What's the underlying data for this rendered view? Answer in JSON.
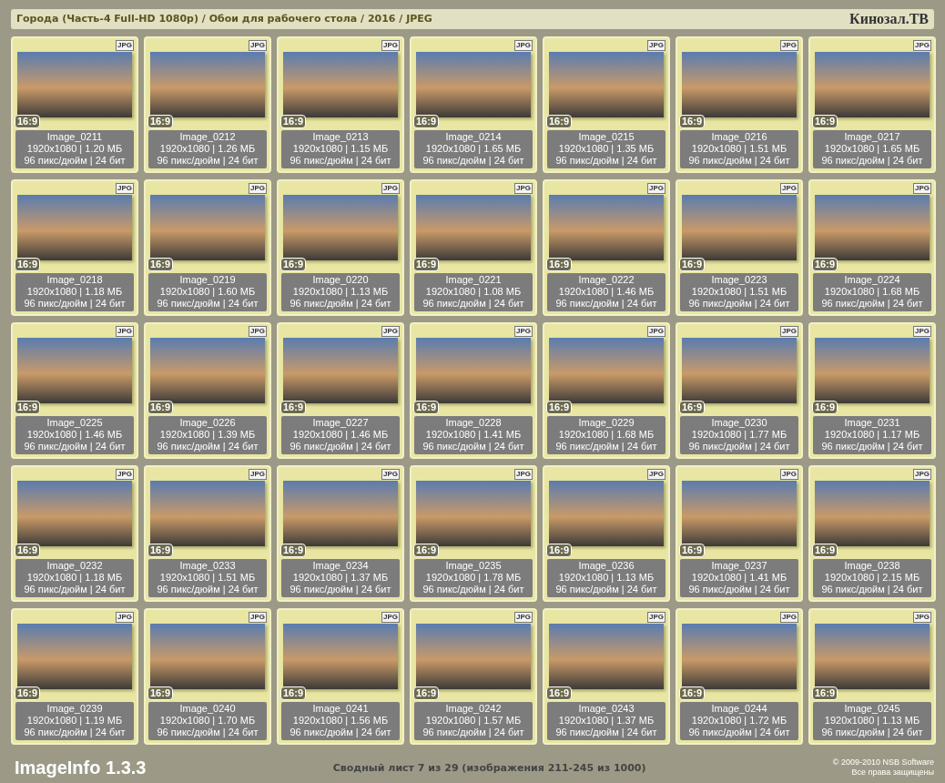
{
  "header": {
    "title": "Города (Часть-4 Full-HD 1080p) / Обои для рабочего стола / 2016 / JPEG",
    "site": "Кинозал.ТВ"
  },
  "tiles": [
    {
      "format": "JPG",
      "ratio": "16:9",
      "name": "Image_0211",
      "size": "1920x1080 | 1.20 МБ",
      "info": "96 пикс/дюйм | 24 бит"
    },
    {
      "format": "JPG",
      "ratio": "16:9",
      "name": "Image_0212",
      "size": "1920x1080 | 1.26 МБ",
      "info": "96 пикс/дюйм | 24 бит"
    },
    {
      "format": "JPG",
      "ratio": "16:9",
      "name": "Image_0213",
      "size": "1920x1080 | 1.15 МБ",
      "info": "96 пикс/дюйм | 24 бит"
    },
    {
      "format": "JPG",
      "ratio": "16:9",
      "name": "Image_0214",
      "size": "1920x1080 | 1.65 МБ",
      "info": "96 пикс/дюйм | 24 бит"
    },
    {
      "format": "JPG",
      "ratio": "16:9",
      "name": "Image_0215",
      "size": "1920x1080 | 1.35 МБ",
      "info": "96 пикс/дюйм | 24 бит"
    },
    {
      "format": "JPG",
      "ratio": "16:9",
      "name": "Image_0216",
      "size": "1920x1080 | 1.51 МБ",
      "info": "96 пикс/дюйм | 24 бит"
    },
    {
      "format": "JPG",
      "ratio": "16:9",
      "name": "Image_0217",
      "size": "1920x1080 | 1.65 МБ",
      "info": "96 пикс/дюйм | 24 бит"
    },
    {
      "format": "JPG",
      "ratio": "16:9",
      "name": "Image_0218",
      "size": "1920x1080 | 1.18 МБ",
      "info": "96 пикс/дюйм | 24 бит"
    },
    {
      "format": "JPG",
      "ratio": "16:9",
      "name": "Image_0219",
      "size": "1920x1080 | 1.60 МБ",
      "info": "96 пикс/дюйм | 24 бит"
    },
    {
      "format": "JPG",
      "ratio": "16:9",
      "name": "Image_0220",
      "size": "1920x1080 | 1.13 МБ",
      "info": "96 пикс/дюйм | 24 бит"
    },
    {
      "format": "JPG",
      "ratio": "16:9",
      "name": "Image_0221",
      "size": "1920x1080 | 1.08 МБ",
      "info": "96 пикс/дюйм | 24 бит"
    },
    {
      "format": "JPG",
      "ratio": "16:9",
      "name": "Image_0222",
      "size": "1920x1080 | 1.46 МБ",
      "info": "96 пикс/дюйм | 24 бит"
    },
    {
      "format": "JPG",
      "ratio": "16:9",
      "name": "Image_0223",
      "size": "1920x1080 | 1.51 МБ",
      "info": "96 пикс/дюйм | 24 бит"
    },
    {
      "format": "JPG",
      "ratio": "16:9",
      "name": "Image_0224",
      "size": "1920x1080 | 1.68 МБ",
      "info": "96 пикс/дюйм | 24 бит"
    },
    {
      "format": "JPG",
      "ratio": "16:9",
      "name": "Image_0225",
      "size": "1920x1080 | 1.46 МБ",
      "info": "96 пикс/дюйм | 24 бит"
    },
    {
      "format": "JPG",
      "ratio": "16:9",
      "name": "Image_0226",
      "size": "1920x1080 | 1.39 МБ",
      "info": "96 пикс/дюйм | 24 бит"
    },
    {
      "format": "JPG",
      "ratio": "16:9",
      "name": "Image_0227",
      "size": "1920x1080 | 1.46 МБ",
      "info": "96 пикс/дюйм | 24 бит"
    },
    {
      "format": "JPG",
      "ratio": "16:9",
      "name": "Image_0228",
      "size": "1920x1080 | 1.41 МБ",
      "info": "96 пикс/дюйм | 24 бит"
    },
    {
      "format": "JPG",
      "ratio": "16:9",
      "name": "Image_0229",
      "size": "1920x1080 | 1.68 МБ",
      "info": "96 пикс/дюйм | 24 бит"
    },
    {
      "format": "JPG",
      "ratio": "16:9",
      "name": "Image_0230",
      "size": "1920x1080 | 1.77 МБ",
      "info": "96 пикс/дюйм | 24 бит"
    },
    {
      "format": "JPG",
      "ratio": "16:9",
      "name": "Image_0231",
      "size": "1920x1080 | 1.17 МБ",
      "info": "96 пикс/дюйм | 24 бит"
    },
    {
      "format": "JPG",
      "ratio": "16:9",
      "name": "Image_0232",
      "size": "1920x1080 | 1.18 МБ",
      "info": "96 пикс/дюйм | 24 бит"
    },
    {
      "format": "JPG",
      "ratio": "16:9",
      "name": "Image_0233",
      "size": "1920x1080 | 1.51 МБ",
      "info": "96 пикс/дюйм | 24 бит"
    },
    {
      "format": "JPG",
      "ratio": "16:9",
      "name": "Image_0234",
      "size": "1920x1080 | 1.37 МБ",
      "info": "96 пикс/дюйм | 24 бит"
    },
    {
      "format": "JPG",
      "ratio": "16:9",
      "name": "Image_0235",
      "size": "1920x1080 | 1.78 МБ",
      "info": "96 пикс/дюйм | 24 бит"
    },
    {
      "format": "JPG",
      "ratio": "16:9",
      "name": "Image_0236",
      "size": "1920x1080 | 1.13 МБ",
      "info": "96 пикс/дюйм | 24 бит"
    },
    {
      "format": "JPG",
      "ratio": "16:9",
      "name": "Image_0237",
      "size": "1920x1080 | 1.41 МБ",
      "info": "96 пикс/дюйм | 24 бит"
    },
    {
      "format": "JPG",
      "ratio": "16:9",
      "name": "Image_0238",
      "size": "1920x1080 | 2.15 МБ",
      "info": "96 пикс/дюйм | 24 бит"
    },
    {
      "format": "JPG",
      "ratio": "16:9",
      "name": "Image_0239",
      "size": "1920x1080 | 1.19 МБ",
      "info": "96 пикс/дюйм | 24 бит"
    },
    {
      "format": "JPG",
      "ratio": "16:9",
      "name": "Image_0240",
      "size": "1920x1080 | 1.70 МБ",
      "info": "96 пикс/дюйм | 24 бит"
    },
    {
      "format": "JPG",
      "ratio": "16:9",
      "name": "Image_0241",
      "size": "1920x1080 | 1.56 МБ",
      "info": "96 пикс/дюйм | 24 бит"
    },
    {
      "format": "JPG",
      "ratio": "16:9",
      "name": "Image_0242",
      "size": "1920x1080 | 1.57 МБ",
      "info": "96 пикс/дюйм | 24 бит"
    },
    {
      "format": "JPG",
      "ratio": "16:9",
      "name": "Image_0243",
      "size": "1920x1080 | 1.37 МБ",
      "info": "96 пикс/дюйм | 24 бит"
    },
    {
      "format": "JPG",
      "ratio": "16:9",
      "name": "Image_0244",
      "size": "1920x1080 | 1.72 МБ",
      "info": "96 пикс/дюйм | 24 бит"
    },
    {
      "format": "JPG",
      "ratio": "16:9",
      "name": "Image_0245",
      "size": "1920x1080 | 1.13 МБ",
      "info": "96 пикс/дюйм | 24 бит"
    }
  ],
  "footer": {
    "app": "ImageInfo 1.3.3",
    "sheet": "Сводный лист 7 из 29 (изображения 211-245 из 1000)",
    "copyright": "© 2009-2010 NSB Software",
    "rights": "Все права защищены"
  }
}
